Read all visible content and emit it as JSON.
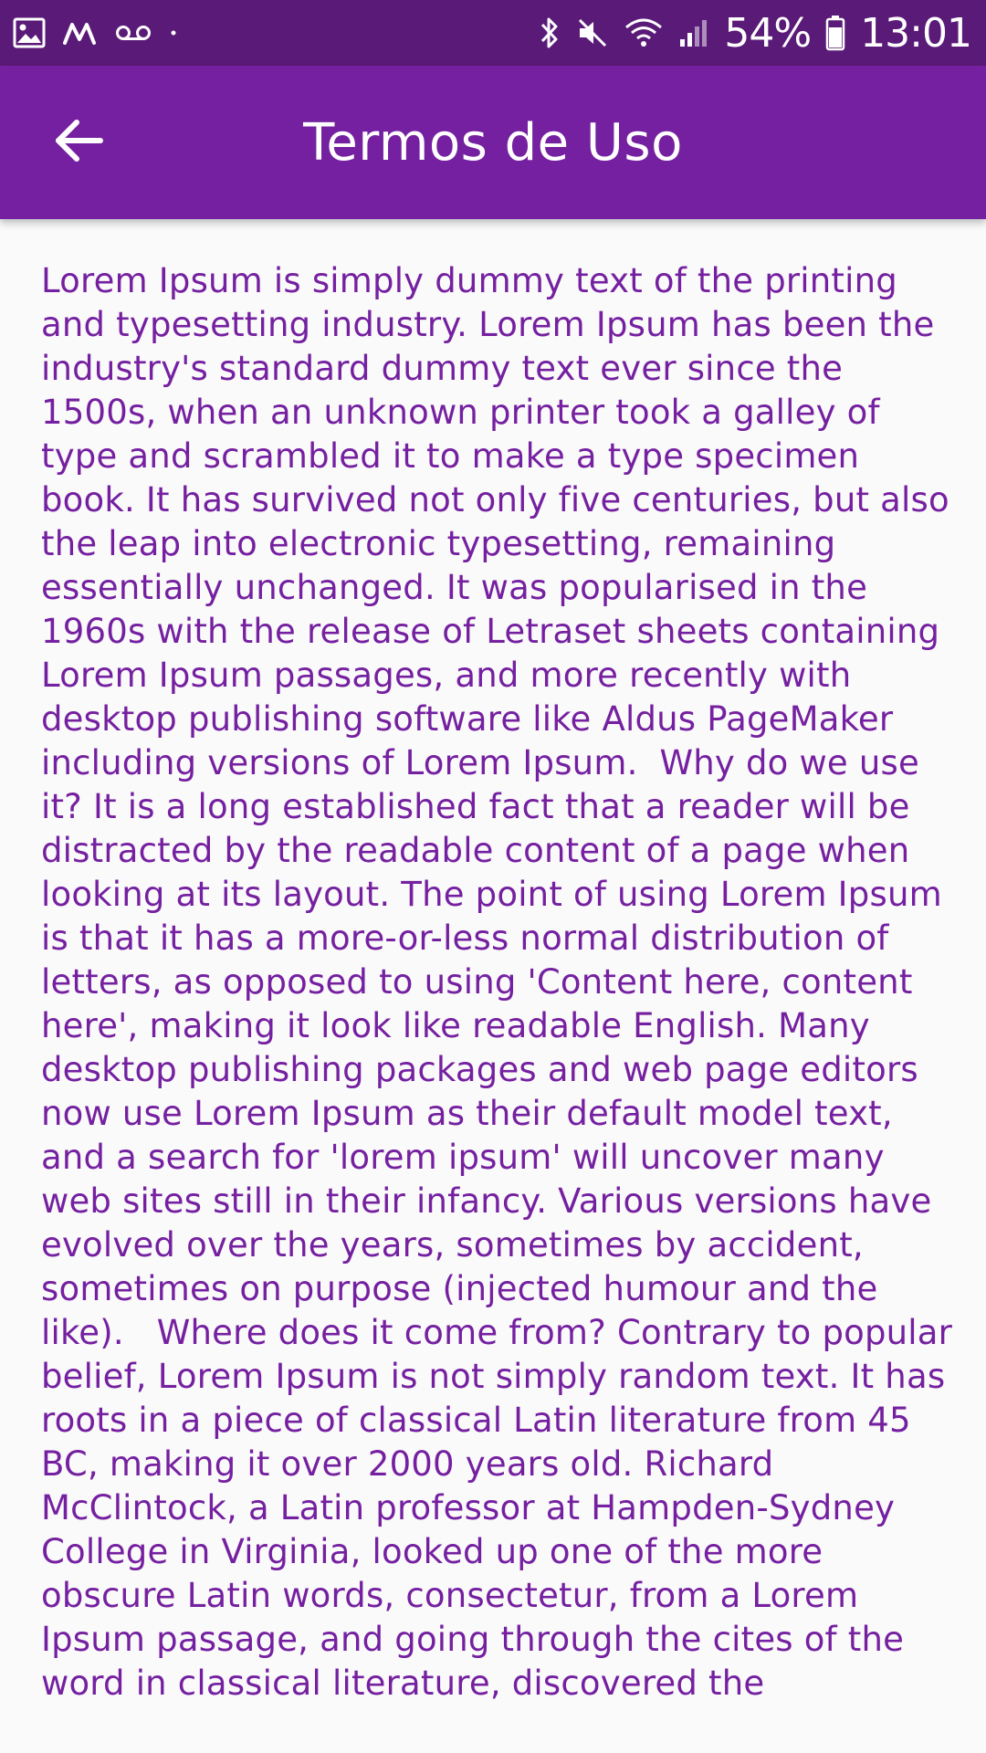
{
  "status_bar": {
    "icons_left": [
      "image-icon",
      "m-app-icon",
      "voicemail-icon",
      "dot-icon"
    ],
    "icons_right": [
      "bluetooth-icon",
      "mute-icon",
      "wifi-icon",
      "signal-icon",
      "battery-icon"
    ],
    "battery": "54%",
    "time": "13:01"
  },
  "app_bar": {
    "title": "Termos de Uso",
    "back_icon": "arrow-back-icon"
  },
  "colors": {
    "status_bar": "#5a1a78",
    "app_bar": "#7520a0",
    "text": "#7520a0",
    "background": "#fafafa"
  },
  "content": {
    "body": "Lorem Ipsum is simply dummy text of the printing and typesetting industry. Lorem Ipsum has been the industry's standard dummy text ever since the 1500s, when an unknown printer took a galley of type and scrambled it to make a type specimen book. It has survived not only five centuries, but also the leap into electronic typesetting, remaining essentially unchanged. It was popularised in the 1960s with the release of Letraset sheets containing Lorem Ipsum passages, and more recently with desktop publishing software like Aldus PageMaker including versions of Lorem Ipsum.  Why do we use it? It is a long established fact that a reader will be distracted by the readable content of a page when looking at its layout. The point of using Lorem Ipsum is that it has a more-or-less normal distribution of letters, as opposed to using 'Content here, content here', making it look like readable English. Many desktop publishing packages and web page editors now use Lorem Ipsum as their default model text, and a search for 'lorem ipsum' will uncover many web sites still in their infancy. Various versions have evolved over the years, sometimes by accident, sometimes on purpose (injected humour and the like).   Where does it come from? Contrary to popular belief, Lorem Ipsum is not simply random text. It has roots in a piece of classical Latin literature from 45 BC, making it over 2000 years old. Richard McClintock, a Latin professor at Hampden-Sydney College in Virginia, looked up one of the more obscure Latin words, consectetur, from a Lorem Ipsum passage, and going through the cites of the word in classical literature, discovered the"
  }
}
